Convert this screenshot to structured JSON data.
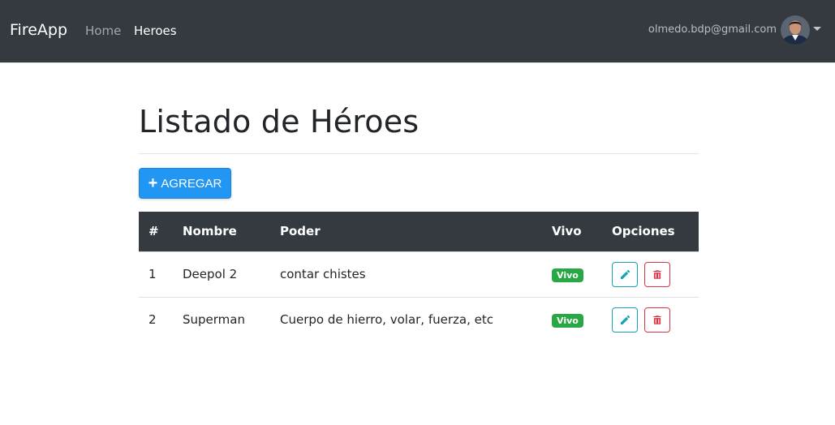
{
  "navbar": {
    "brand": "FireApp",
    "links": [
      {
        "label": "Home",
        "active": false
      },
      {
        "label": "Heroes",
        "active": true
      }
    ],
    "user_email": "olmedo.bdp@gmail.com"
  },
  "page": {
    "title": "Listado de Héroes",
    "add_button_label": "AGREGAR"
  },
  "table": {
    "headers": [
      "#",
      "Nombre",
      "Poder",
      "Vivo",
      "Opciones"
    ],
    "rows": [
      {
        "index": "1",
        "name": "Deepol 2",
        "power": "contar chistes",
        "status": "Vivo"
      },
      {
        "index": "2",
        "name": "Superman",
        "power": "Cuerpo de hierro, volar, fuerza, etc",
        "status": "Vivo"
      }
    ]
  },
  "icons": {
    "add": "plus-icon",
    "edit": "pencil-icon",
    "delete": "trash-icon",
    "menu": "caret-down-icon"
  },
  "colors": {
    "navbar": "#343a40",
    "primary": "#2196f3",
    "success": "#28a745",
    "info": "#17a2b8",
    "danger": "#dc3545"
  }
}
